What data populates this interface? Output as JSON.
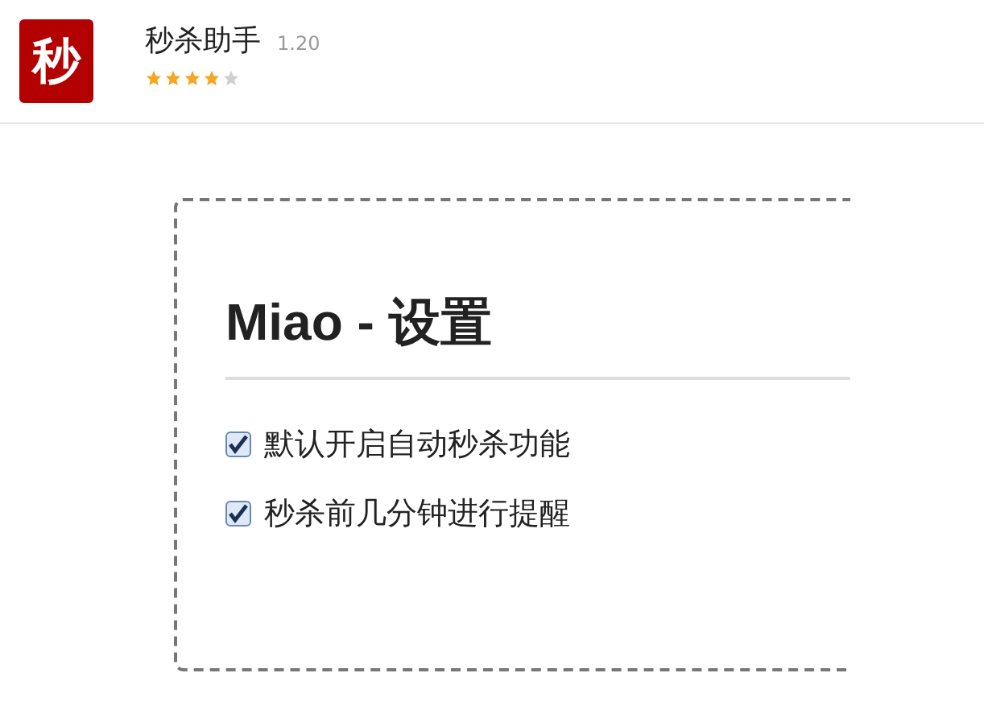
{
  "app": {
    "logo": "秒",
    "name": "秒杀助手",
    "version": "1.20",
    "stars": 4
  },
  "settings": {
    "title": "Miao - 设置",
    "options": [
      {
        "label": "默认开启自动秒杀功能",
        "checked": true
      },
      {
        "label": "秒杀前几分钟进行提醒",
        "checked": true
      }
    ]
  }
}
